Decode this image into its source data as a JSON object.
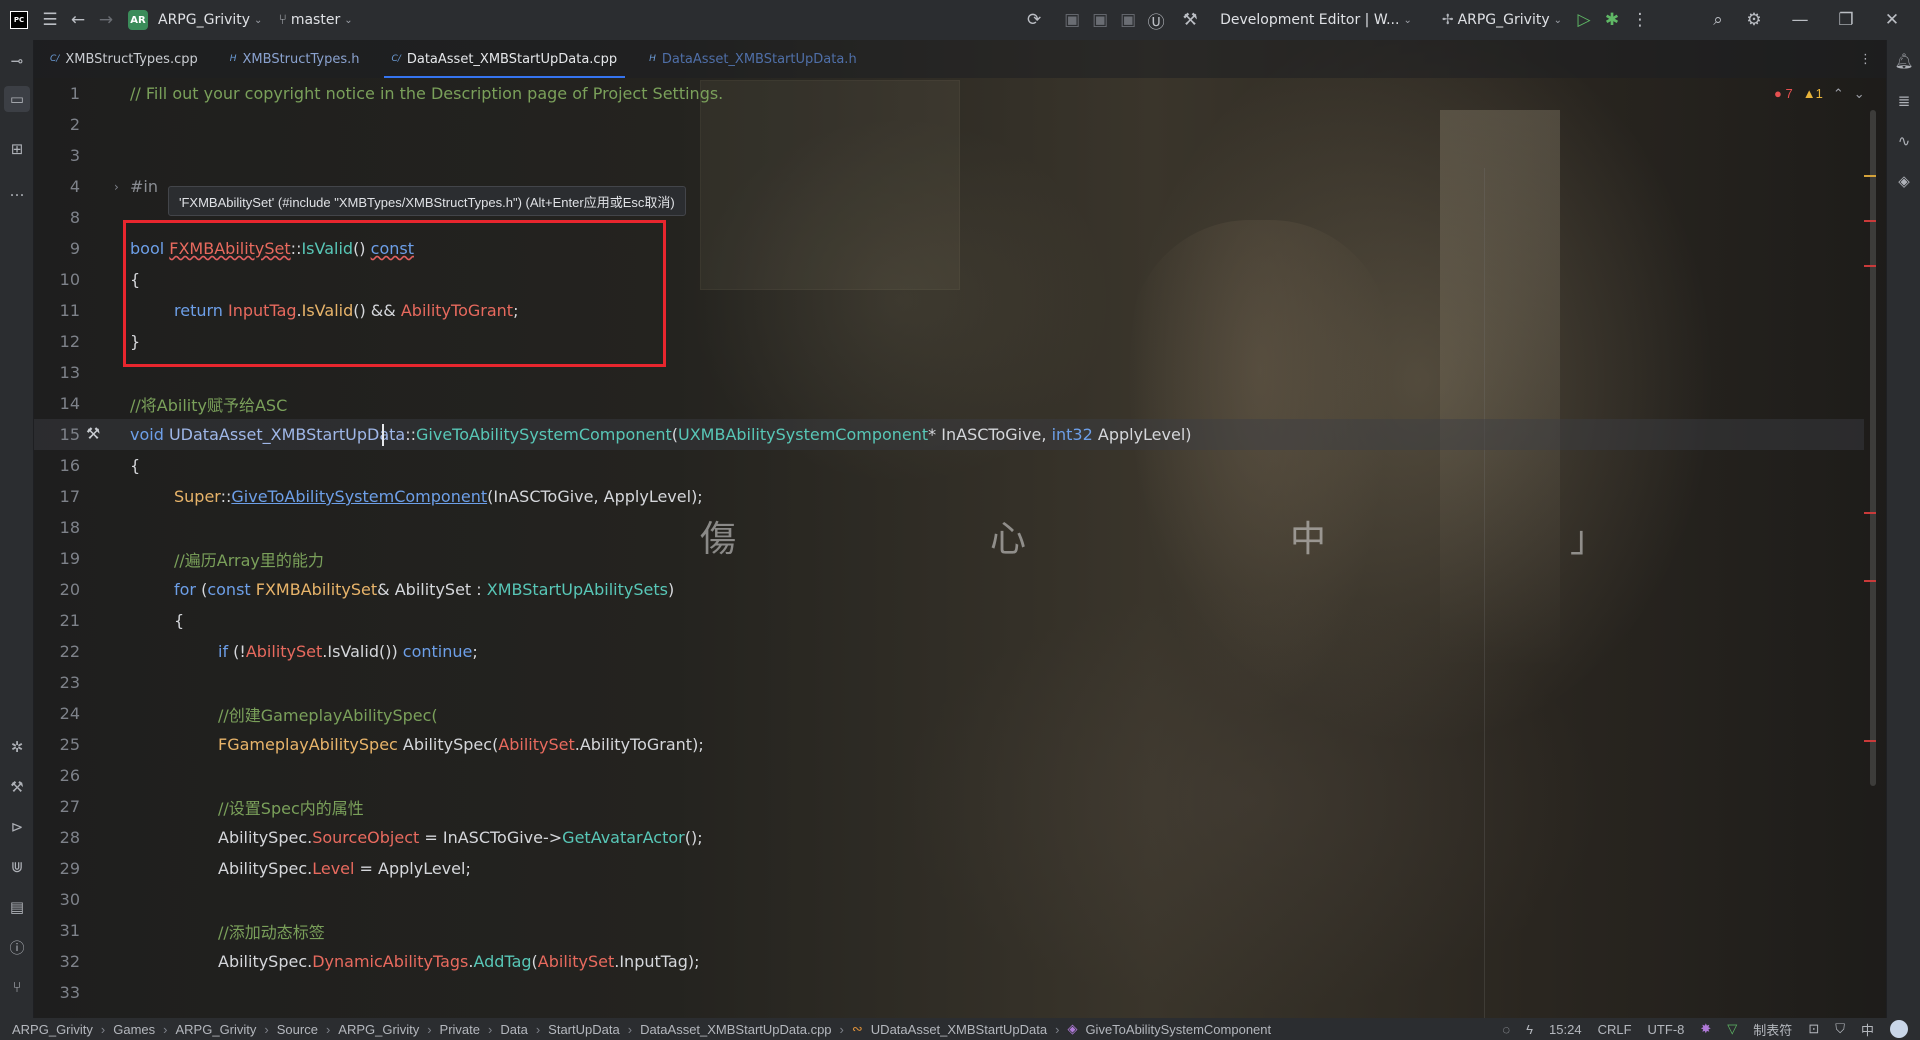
{
  "topbar": {
    "logo_text": "PC",
    "project_badge": "AR",
    "project_name": "ARPG_Grivity",
    "branch": "master",
    "run_config": "Development Editor | W...",
    "target": "ARPG_Grivity"
  },
  "tabs": [
    {
      "label": "XMBStructTypes.cpp",
      "icon": "C/"
    },
    {
      "label": "XMBStructTypes.h",
      "icon": "H"
    },
    {
      "label": "DataAsset_XMBStartUpData.cpp",
      "icon": "C/"
    },
    {
      "label": "DataAsset_XMBStartUpData.h",
      "icon": "H"
    }
  ],
  "inspections": {
    "errors": "7",
    "warnings": "1"
  },
  "tooltip": "'FXMBAbilitySet' (#include \"XMBTypes/XMBStructTypes.h\") (Alt+Enter应用或Esc取消)",
  "line_numbers": [
    "1",
    "2",
    "3",
    "4",
    "8",
    "9",
    "10",
    "11",
    "12",
    "13",
    "14",
    "15",
    "16",
    "17",
    "18",
    "19",
    "20",
    "21",
    "22",
    "23",
    "24",
    "25",
    "26",
    "27",
    "28",
    "29",
    "30",
    "31",
    "32",
    "33"
  ],
  "code": {
    "l1": "// Fill out your copyright notice in the Description page of Project Settings.",
    "l4": "#in",
    "l9_kw": "bool ",
    "l9_cls": "FXMBAbilitySet",
    "l9_sep": "::",
    "l9_fn": "IsValid",
    "l9_par": "() ",
    "l9_const": "const",
    "l10": "{",
    "l11_ret": "return ",
    "l11_m1": "InputTag",
    "l11_dot": ".",
    "l11_fn": "IsValid",
    "l11_and": "() && ",
    "l11_m2": "AbilityToGrant",
    "l11_end": ";",
    "l12": "}",
    "l14": "//将Ability赋予给ASC",
    "l15_kw": "void ",
    "l15_cls": "UDataAsset_XMBStartUpData",
    "l15_sep": "::",
    "l15_fn": "GiveToAbilitySystemComponent",
    "l15_op": "(",
    "l15_t1": "UXMBAbilitySystemComponent",
    "l15_p1": "* InASCToGive, ",
    "l15_t2": "int32",
    "l15_p2": " ApplyLevel)",
    "l16": "{",
    "l17_cls": "Super",
    "l17_sep": "::",
    "l17_fn": "GiveToAbilitySystemComponent",
    "l17_rest": "(InASCToGive, ApplyLevel);",
    "l19": "//遍历Array里的能力",
    "l20_kw": "for ",
    "l20_a": "(",
    "l20_kw2": "const ",
    "l20_cls": "FXMBAbilitySet",
    "l20_b": "& AbilitySet : ",
    "l20_mem": "XMBStartUpAbilitySets",
    "l20_c": ")",
    "l21": "{",
    "l22_kw": "if ",
    "l22_a": "(!",
    "l22_m": "AbilitySet",
    "l22_b": ".IsValid()) ",
    "l22_kw2": "continue",
    "l22_c": ";",
    "l24": "//创建GameplayAbilitySpec(",
    "l25_cls": "FGameplayAbilitySpec",
    "l25_a": " AbilitySpec(",
    "l25_m": "AbilitySet",
    "l25_b": ".AbilityToGrant);",
    "l27": "//设置Spec内的属性",
    "l28_a": "AbilitySpec.",
    "l28_m": "SourceObject",
    "l28_b": " = InASCToGive->",
    "l28_fn": "GetAvatarActor",
    "l28_c": "();",
    "l29_a": "AbilitySpec.",
    "l29_m": "Level",
    "l29_b": " = ApplyLevel;",
    "l31": "//添加动态标签",
    "l32_a": "AbilitySpec.",
    "l32_m": "DynamicAbilityTags",
    "l32_dot": ".",
    "l32_fn": "AddTag",
    "l32_b": "(",
    "l32_m2": "AbilitySet",
    "l32_c": ".InputTag);"
  },
  "wallpaper_text": [
    "傷",
    "心",
    "中",
    "」"
  ],
  "status": {
    "breadcrumbs": [
      "ARPG_Grivity",
      "Games",
      "ARPG_Grivity",
      "Source",
      "ARPG_Grivity",
      "Private",
      "Data",
      "StartUpData",
      "DataAsset_XMBStartUpData.cpp",
      "UDataAsset_XMBStartUpData",
      "GiveToAbilitySystemComponent"
    ],
    "position": "15:24",
    "line_ending": "CRLF",
    "encoding": "UTF-8",
    "indent": "制表符",
    "ime": "中"
  },
  "colors": {
    "accent": "#3574f0",
    "error": "#e55050",
    "highlight_box": "#e8262e"
  }
}
